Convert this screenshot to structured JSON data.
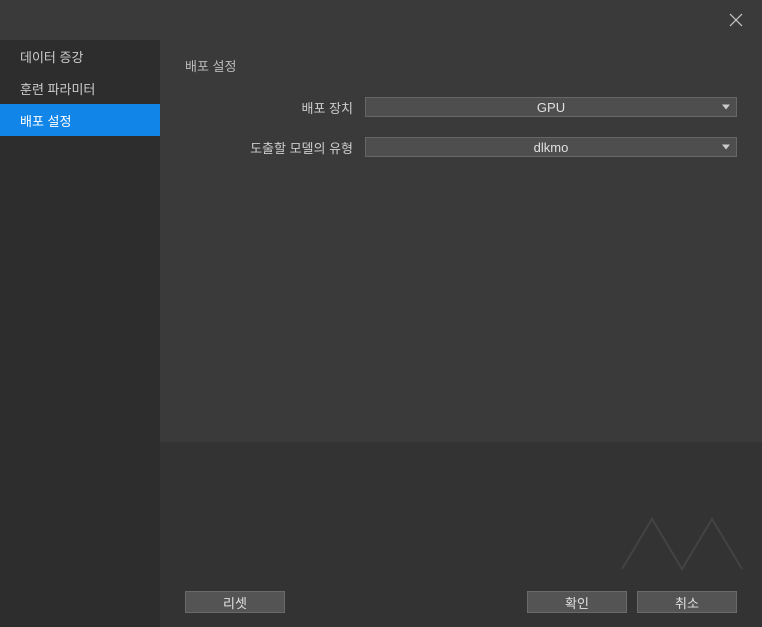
{
  "sidebar": {
    "items": [
      {
        "label": "데이터 증강"
      },
      {
        "label": "훈련 파라미터"
      },
      {
        "label": "배포 설정"
      }
    ]
  },
  "main": {
    "title": "배포 설정",
    "rows": [
      {
        "label": "배포 장치",
        "value": "GPU"
      },
      {
        "label": "도출할 모델의 유형",
        "value": "dlkmo"
      }
    ]
  },
  "footer": {
    "reset": "리셋",
    "confirm": "확인",
    "cancel": "취소"
  }
}
